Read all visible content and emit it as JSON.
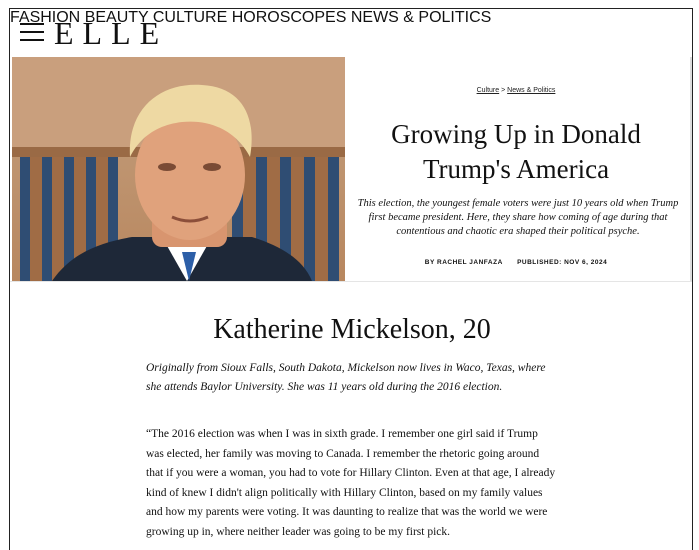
{
  "header": {
    "logo": "ELLE",
    "nav": [
      "FASHION",
      "BEAUTY",
      "CULTURE",
      "HOROSCOPES",
      "NEWS & POLITICS"
    ]
  },
  "article": {
    "breadcrumb": {
      "section": "Culture",
      "separator": " > ",
      "subsection": "News & Politics"
    },
    "title": "Growing Up in Donald Trump's America",
    "dek": "This election, the youngest female voters were just 10 years old when Trump first became president. Here, they share how coming of age during that contentious and chaotic era shaped their political psyche.",
    "author": "BY RACHEL JANFAZA",
    "published": "PUBLISHED: NOV 6, 2024"
  },
  "section": {
    "name": "Katherine Mickelson, 20",
    "intro": "Originally from Sioux Falls, South Dakota, Mickelson now lives in Waco, Texas, where she attends Baylor University. She was 11 years old during the 2016 election.",
    "quote": "“The 2016 election was when I was in sixth grade. I remember one girl said if Trump was elected, her family was moving to Canada. I remember the rhetoric going around that if you were a woman, you had to vote for Hillary Clinton. Even at that age, I already kind of knew I didn't align politically with Hillary Clinton, based on my family values and how my parents were voting. It was daunting to realize that was the world we were growing up in, where neither leader was going to be my first pick."
  },
  "colors": {
    "text": "#111111",
    "background": "#ffffff"
  }
}
